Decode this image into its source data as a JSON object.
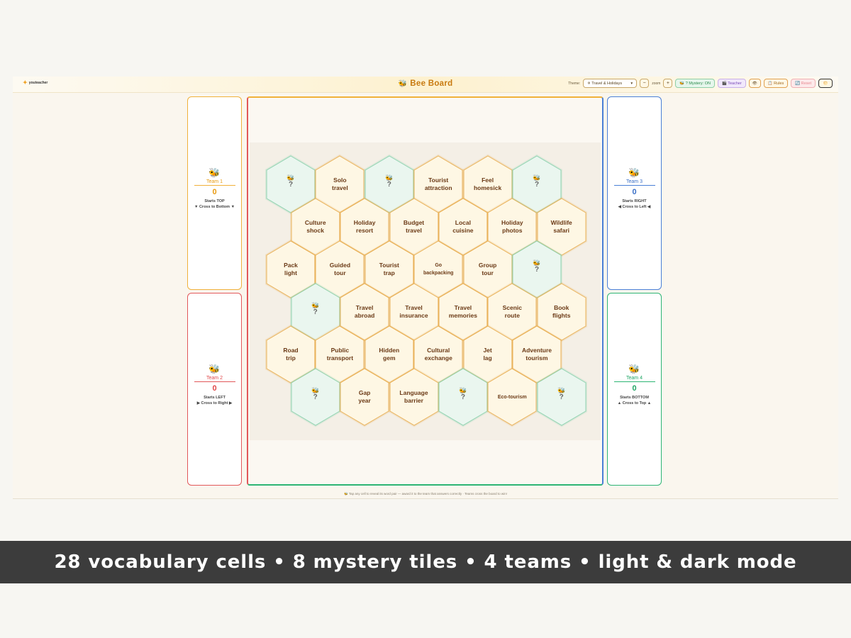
{
  "header": {
    "logo_text": "youteacher",
    "logo_mark": "✦",
    "title": "Bee Board",
    "title_icon": "🐝",
    "theme_label": "Theme:",
    "theme_value": "✈ Travel & Holidays",
    "theme_caret": "▾",
    "zoom_minus": "−",
    "zoom_label": "zoom",
    "zoom_plus": "+",
    "mystery_label": "🐝 ? Mystery: ON",
    "teacher_label": "🎬 Teacher",
    "eye_icon": "👁",
    "rules_label": "📋 Rules",
    "reset_label": "🔄 Reset",
    "mode_icon": "🌕"
  },
  "teams": [
    {
      "name": "Team 1",
      "score": "0",
      "start": "Starts TOP",
      "cross": "▼ Cross to Bottom ▼",
      "icon": "🐝"
    },
    {
      "name": "Team 2",
      "score": "0",
      "start": "Starts LEFT",
      "cross": "▶ Cross to Right ▶",
      "icon": "🐝"
    },
    {
      "name": "Team 3",
      "score": "0",
      "start": "Starts RIGHT",
      "cross": "◀ Cross to Left ◀",
      "icon": "🐝"
    },
    {
      "name": "Team 4",
      "score": "0",
      "start": "Starts BOTTOM",
      "cross": "▲ Cross to Top ▲",
      "icon": "🐝"
    }
  ],
  "board": {
    "mystery_icon": "🐝",
    "mystery_mark": "?",
    "rows": [
      [
        {
          "type": "mystery"
        },
        {
          "type": "word",
          "text": "Solo\ntravel"
        },
        {
          "type": "mystery"
        },
        {
          "type": "word",
          "text": "Tourist\nattraction"
        },
        {
          "type": "word",
          "text": "Feel\nhomesick"
        },
        {
          "type": "mystery"
        }
      ],
      [
        {
          "type": "word",
          "text": "Culture\nshock"
        },
        {
          "type": "word",
          "text": "Holiday\nresort"
        },
        {
          "type": "word",
          "text": "Budget\ntravel"
        },
        {
          "type": "word",
          "text": "Local\ncuisine"
        },
        {
          "type": "word",
          "text": "Holiday\nphotos"
        },
        {
          "type": "word",
          "text": "Wildlife\nsafari"
        }
      ],
      [
        {
          "type": "word",
          "text": "Pack\nlight"
        },
        {
          "type": "word",
          "text": "Guided\ntour"
        },
        {
          "type": "word",
          "text": "Tourist\ntrap"
        },
        {
          "type": "word",
          "text": "Go\nbackpacking",
          "small": true
        },
        {
          "type": "word",
          "text": "Group\ntour"
        },
        {
          "type": "mystery"
        }
      ],
      [
        {
          "type": "mystery"
        },
        {
          "type": "word",
          "text": "Travel\nabroad"
        },
        {
          "type": "word",
          "text": "Travel\ninsurance"
        },
        {
          "type": "word",
          "text": "Travel\nmemories"
        },
        {
          "type": "word",
          "text": "Scenic\nroute"
        },
        {
          "type": "word",
          "text": "Book\nflights"
        }
      ],
      [
        {
          "type": "word",
          "text": "Road\ntrip"
        },
        {
          "type": "word",
          "text": "Public\ntransport"
        },
        {
          "type": "word",
          "text": "Hidden\ngem"
        },
        {
          "type": "word",
          "text": "Cultural\nexchange"
        },
        {
          "type": "word",
          "text": "Jet\nlag"
        },
        {
          "type": "word",
          "text": "Adventure\ntourism"
        }
      ],
      [
        {
          "type": "mystery"
        },
        {
          "type": "word",
          "text": "Gap\nyear"
        },
        {
          "type": "word",
          "text": "Language\nbarrier"
        },
        {
          "type": "mystery"
        },
        {
          "type": "word",
          "text": "Eco-tourism",
          "small": true
        },
        {
          "type": "mystery"
        }
      ]
    ]
  },
  "footer_hint": "🐝 Tap any cell to reveal its word pair — award it to the team that answers correctly · Teams cross the board to win!",
  "banner_text": "28 vocabulary cells • 8 mystery tiles • 4 teams • light & dark mode",
  "colors": {
    "team1": "#f0b13a",
    "team2": "#e2585a",
    "team3": "#4a7fd6",
    "team4": "#2db574",
    "word_fill": "#fef7e4",
    "word_stroke": "#e9b25a",
    "mystery_fill": "#eaf6ef",
    "mystery_stroke": "#8fd3b0"
  }
}
